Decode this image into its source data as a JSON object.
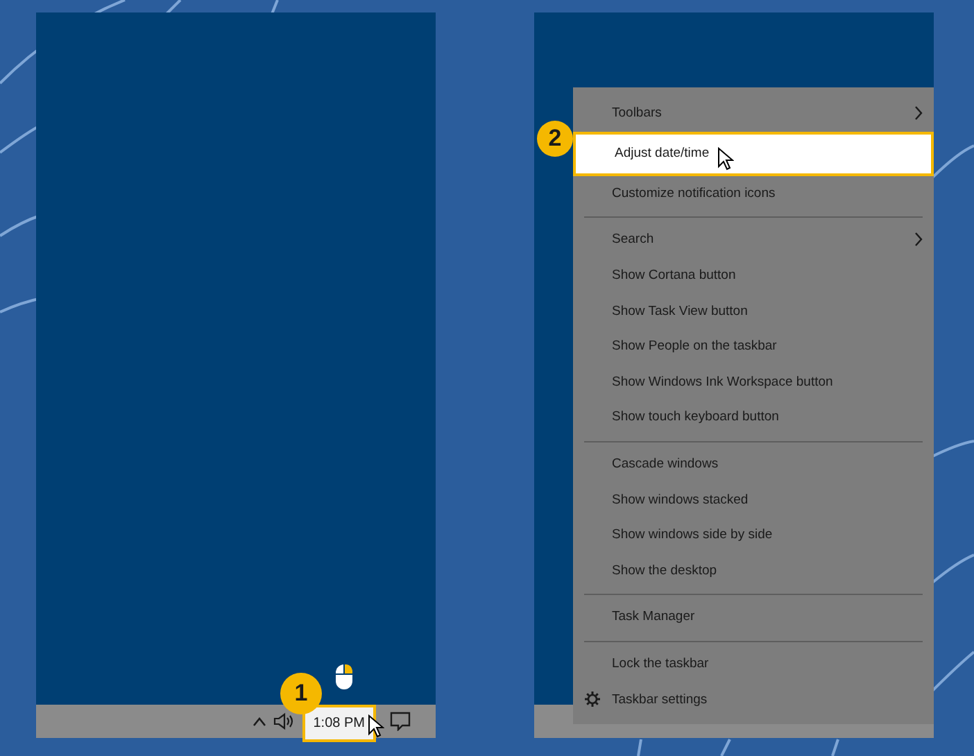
{
  "left_screen": {
    "step_badge": "1",
    "taskbar": {
      "clock": {
        "label": "1:08 PM",
        "highlighted": true
      }
    }
  },
  "context_menu": {
    "step_badge": "2",
    "groups": [
      [
        {
          "label": "Toolbars",
          "kind": "submenu",
          "selected": false
        },
        {
          "label": "Adjust date/time",
          "kind": "plain",
          "selected": true
        },
        {
          "label": "Customize notification icons",
          "kind": "plain",
          "selected": false
        }
      ],
      [
        {
          "label": "Search",
          "kind": "submenu",
          "selected": false
        },
        {
          "label": "Show Cortana button",
          "kind": "plain",
          "selected": false
        },
        {
          "label": "Show Task View button",
          "kind": "plain",
          "selected": false
        },
        {
          "label": "Show People on the taskbar",
          "kind": "plain",
          "selected": false
        },
        {
          "label": "Show Windows Ink Workspace button",
          "kind": "plain",
          "selected": false
        },
        {
          "label": "Show touch keyboard button",
          "kind": "plain",
          "selected": false
        }
      ],
      [
        {
          "label": "Cascade windows",
          "kind": "plain",
          "selected": false
        },
        {
          "label": "Show windows stacked",
          "kind": "plain",
          "selected": false
        },
        {
          "label": "Show windows side by side",
          "kind": "plain",
          "selected": false
        },
        {
          "label": "Show the desktop",
          "kind": "plain",
          "selected": false
        }
      ],
      [
        {
          "label": "Task Manager",
          "kind": "plain",
          "selected": false
        }
      ],
      [
        {
          "label": "Lock the taskbar",
          "kind": "plain",
          "selected": false
        },
        {
          "label": "Taskbar settings",
          "kind": "settings",
          "selected": false
        }
      ]
    ]
  }
}
